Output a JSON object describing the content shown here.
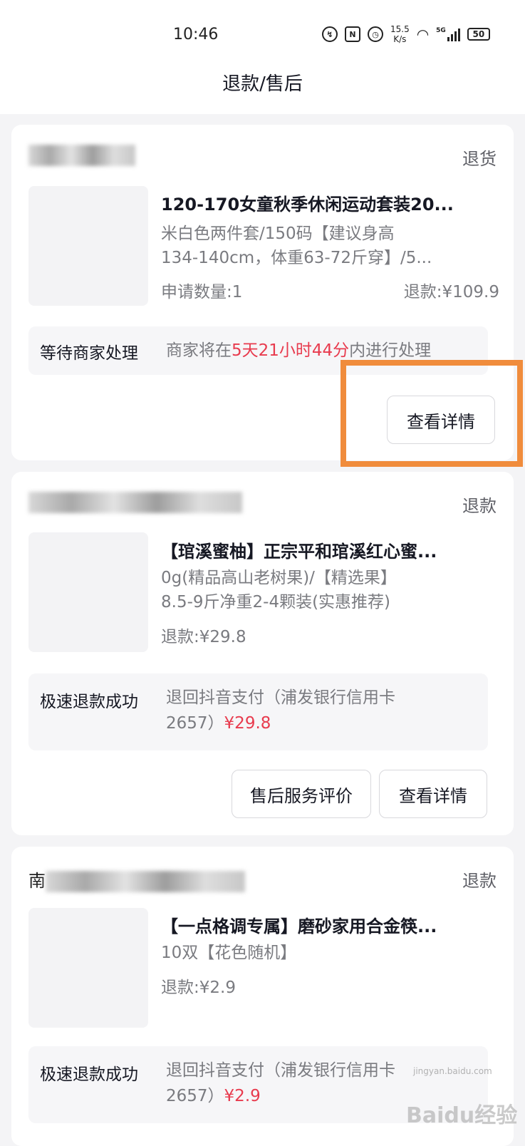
{
  "status_bar": {
    "time": "10:46",
    "speed_value": "15.5",
    "speed_unit": "K/s",
    "network": "5G",
    "battery": "50"
  },
  "header": {
    "title": "退款/售后"
  },
  "orders": [
    {
      "type": "退货",
      "title": "120-170女童秋季休闲运动套装20...",
      "spec_line1": "米白色两件套/150码【建议身高",
      "spec_line2": "134-140cm，体重63-72斤穿】/5...",
      "qty": "申请数量:1",
      "refund": "退款:¥109.9",
      "status_label": "等待商家处理",
      "status_prefix": "商家将在",
      "status_highlight": "5天21小时44分",
      "status_suffix": "内进行处理",
      "button": "查看详情"
    },
    {
      "type": "退款",
      "title": "【琯溪蜜柚】正宗平和琯溪红心蜜...",
      "spec_line1": "0g(精品高山老树果)/【精选果】",
      "spec_line2": "8.5-9斤净重2-4颗装(实惠推荐)",
      "refund": "退款:¥29.8",
      "status_label": "极速退款成功",
      "status_line1": "退回抖音支付（浦发银行信用卡",
      "status_line2_prefix": "2657）",
      "status_amount": "¥29.8",
      "button_review": "售后服务评价",
      "button": "查看详情"
    },
    {
      "shop_prefix": "南",
      "type": "退款",
      "title": "【一点格调专属】磨砂家用合金筷...",
      "spec_line1": "10双【花色随机】",
      "refund": "退款:¥2.9",
      "status_label": "极速退款成功",
      "status_line1": "退回抖音支付（浦发银行信用卡",
      "status_line2_prefix": "2657）",
      "status_amount": "¥2.9"
    }
  ],
  "watermark": {
    "text": "Baidu经验",
    "url": "jingyan.baidu.com"
  }
}
